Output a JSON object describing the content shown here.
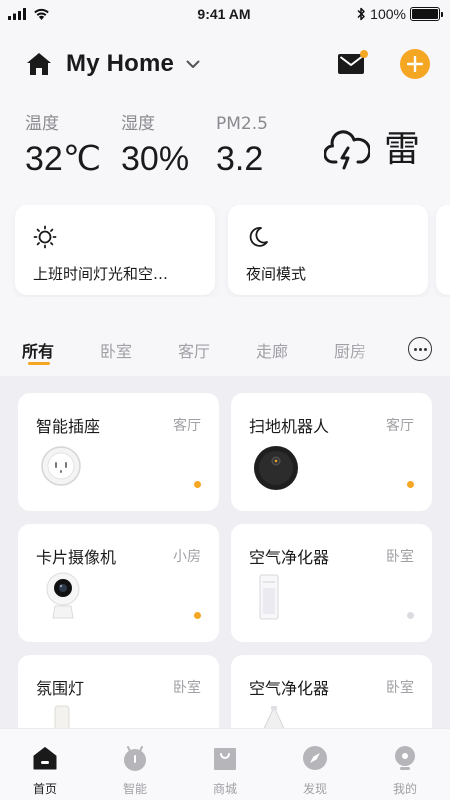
{
  "status_bar": {
    "time": "9:41 AM",
    "battery": "100%"
  },
  "header": {
    "title": "My Home"
  },
  "weather": {
    "temperature": {
      "label": "温度",
      "value": "32℃"
    },
    "humidity": {
      "label": "湿度",
      "value": "30%"
    },
    "pm25": {
      "label": "PM2.5",
      "value": "3.2"
    },
    "condition": "雷",
    "condition_icon": "thunder-cloud-icon"
  },
  "scenes": [
    {
      "icon": "sun-icon",
      "label": "上班时间灯光和空…"
    },
    {
      "icon": "moon-icon",
      "label": "夜间模式"
    }
  ],
  "tabs": [
    {
      "label": "所有",
      "active": true
    },
    {
      "label": "卧室"
    },
    {
      "label": "客厅"
    },
    {
      "label": "走廊"
    },
    {
      "label": "厨房"
    }
  ],
  "devices": [
    {
      "name": "智能插座",
      "room": "客厅",
      "icon": "smart-plug-icon",
      "online": true
    },
    {
      "name": "扫地机器人",
      "room": "客厅",
      "icon": "robot-vacuum-icon",
      "online": true
    },
    {
      "name": "卡片摄像机",
      "room": "小房",
      "icon": "camera-icon",
      "online": true
    },
    {
      "name": "空气净化器",
      "room": "卧室",
      "icon": "air-purifier-icon",
      "online": false
    },
    {
      "name": "氛围灯",
      "room": "卧室",
      "icon": "ambient-lamp-icon"
    },
    {
      "name": "空气净化器",
      "room": "卧室",
      "icon": "air-purifier-icon"
    }
  ],
  "bottom_nav": [
    {
      "label": "首页",
      "icon": "home-icon",
      "active": true
    },
    {
      "label": "智能",
      "icon": "smart-icon"
    },
    {
      "label": "商城",
      "icon": "shop-bag-icon"
    },
    {
      "label": "发现",
      "icon": "discover-compass-icon"
    },
    {
      "label": "我的",
      "icon": "profile-icon"
    }
  ],
  "colors": {
    "accent": "#f5a623",
    "online_dot": "#f5a623",
    "offline_dot": "#dcdce0"
  }
}
